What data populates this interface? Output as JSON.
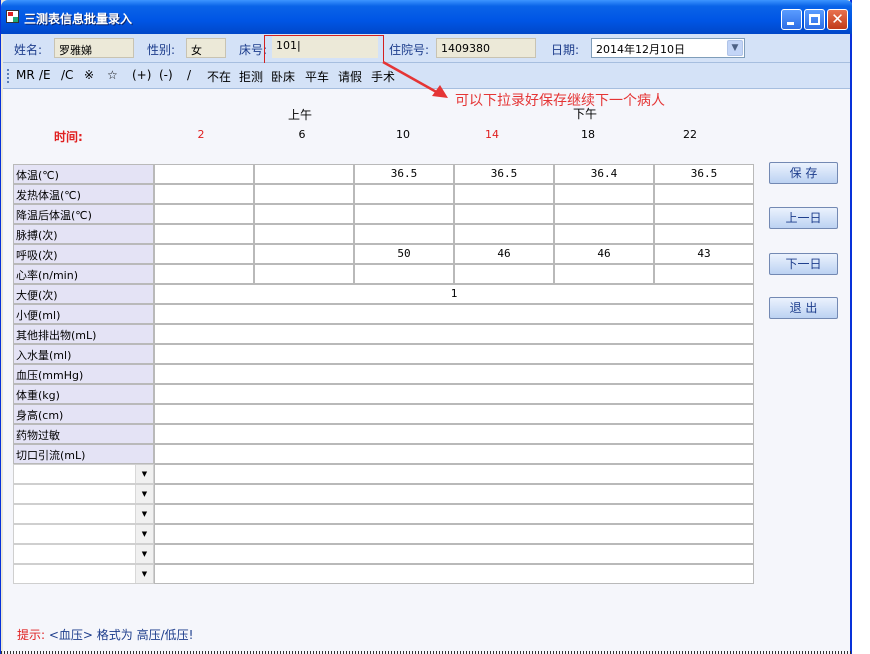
{
  "window": {
    "title": "三测表信息批量录入"
  },
  "patient": {
    "name_label": "姓名:",
    "name_value": "罗雅娣",
    "gender_label": "性别:",
    "gender_value": "女",
    "bed_label": "床号:",
    "bed_value": "101",
    "admission_label": "住院号:",
    "admission_value": "1409380",
    "date_label": "日期:",
    "date_value": "2014年12月10日"
  },
  "toolbar": {
    "items": [
      "MR",
      "/E",
      "/C",
      "※",
      "☆",
      "(+)",
      "(-)",
      "/",
      "不在",
      "拒测",
      "卧床",
      "平车",
      "请假",
      "手术"
    ]
  },
  "annotation": "可以下拉录好保存继续下一个病人",
  "time_header": {
    "am_label": "上午",
    "pm_label": "下午",
    "time_label": "时间:",
    "times": [
      {
        "value": "2",
        "red": true
      },
      {
        "value": "6",
        "red": false
      },
      {
        "value": "10",
        "red": false
      },
      {
        "value": "14",
        "red": true
      },
      {
        "value": "18",
        "red": false
      },
      {
        "value": "22",
        "red": false
      }
    ]
  },
  "rows_timed": [
    {
      "label": "体温(℃)",
      "values": [
        "",
        "",
        "36.5",
        "36.5",
        "36.4",
        "36.5"
      ]
    },
    {
      "label": "发热体温(℃)",
      "values": [
        "",
        "",
        "",
        "",
        "",
        ""
      ]
    },
    {
      "label": "降温后体温(℃)",
      "values": [
        "",
        "",
        "",
        "",
        "",
        ""
      ]
    },
    {
      "label": "脉搏(次)",
      "values": [
        "",
        "",
        "",
        "",
        "",
        ""
      ]
    },
    {
      "label": "呼吸(次)",
      "values": [
        "",
        "",
        "50",
        "46",
        "46",
        "43"
      ]
    },
    {
      "label": "心率(n/min)",
      "values": [
        "",
        "",
        "",
        "",
        "",
        ""
      ]
    }
  ],
  "rows_daily": [
    {
      "label": "大便(次)",
      "value": "1"
    },
    {
      "label": "小便(ml)",
      "value": ""
    },
    {
      "label": "其他排出物(mL)",
      "value": ""
    },
    {
      "label": "入水量(ml)",
      "value": ""
    },
    {
      "label": "血压(mmHg)",
      "value": ""
    },
    {
      "label": "体重(kg)",
      "value": ""
    },
    {
      "label": "身高(cm)",
      "value": ""
    },
    {
      "label": "药物过敏",
      "value": ""
    },
    {
      "label": "切口引流(mL)",
      "value": ""
    }
  ],
  "custom_rows_count": 6,
  "buttons": {
    "save": "保 存",
    "prev_day": "上一日",
    "next_day": "下一日",
    "exit": "退 出"
  },
  "hint": {
    "prefix": "提示:",
    "text": "<血压> 格式为 高压/低压!"
  },
  "colors": {
    "title_blue": "#0055E5",
    "label_blue": "#1D3D8C",
    "red": "#E02020",
    "row_label_bg": "#E4E3F5"
  }
}
